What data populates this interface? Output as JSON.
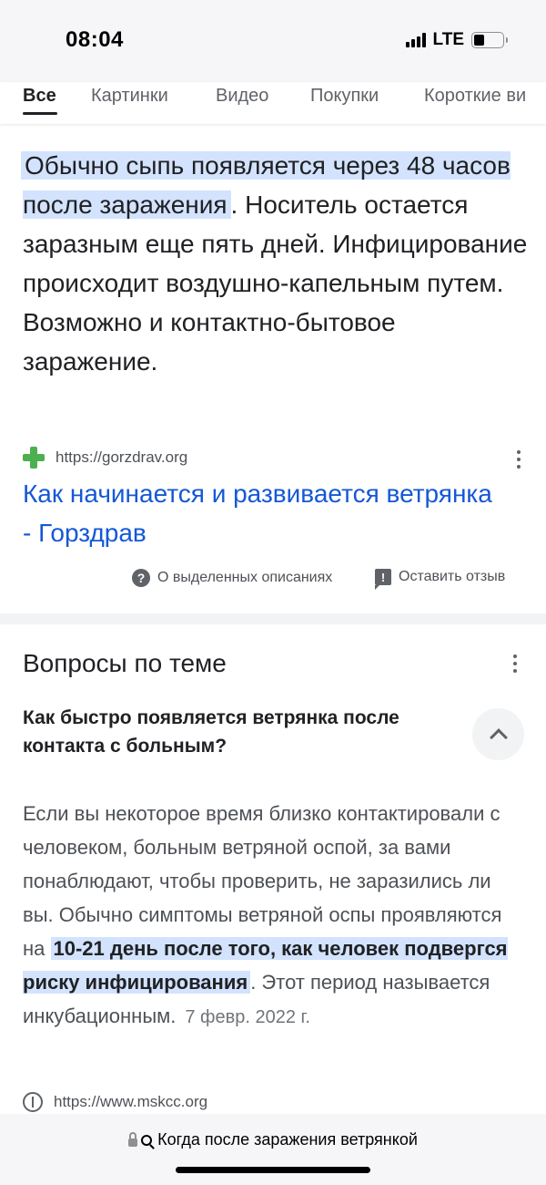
{
  "status_bar": {
    "time": "08:04",
    "network": "LTE",
    "battery_level": 0.35
  },
  "tabs": [
    {
      "label": "Все",
      "active": true
    },
    {
      "label": "Картинки",
      "active": false
    },
    {
      "label": "Видео",
      "active": false
    },
    {
      "label": "Покупки",
      "active": false
    },
    {
      "label": "Короткие ви",
      "active": false
    }
  ],
  "snippet": {
    "highlight": "Обычно сыпь появляется через 48 часов после заражения",
    "rest": ". Носитель остается заразным еще пять дней. Инфицирование происходит воздушно-капельным путем. Возможно и контактно-бытовое заражение.",
    "source_url": "https://gorzdrav.org",
    "source_icon": "green-cross-icon",
    "link_title": "Как начинается и развивается ветрянка - Горздрав",
    "about_label": "О выделенных описаниях",
    "feedback_label": "Оставить отзыв"
  },
  "related": {
    "title": "Вопросы по теме",
    "question": "Как быстро появляется ветрянка после контакта с больным?",
    "answer_before": "Если вы некоторое время близко контактировали с человеком, больным ветряной оспой, за вами понаблюдают, чтобы проверить, не заразились ли вы. Обычно симптомы ветряной оспы проявляются на ",
    "answer_highlight": "10-21 день после того, как человек подвергся риску инфицирования",
    "answer_after": ". Этот период называется инкубационным.",
    "answer_date": "7 февр. 2022 г.",
    "source_url": "https://www.mskcc.org"
  },
  "address_bar": {
    "query": "Когда после заражения ветрянкой"
  },
  "colors": {
    "highlight": "#d3e3fd",
    "link": "#1558d6",
    "favicon_green": "#4caf50"
  }
}
